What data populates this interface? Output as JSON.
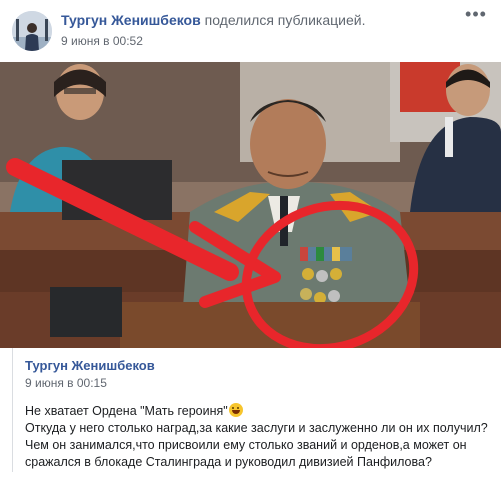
{
  "post": {
    "author": "Тургун Женишбеков",
    "action": "поделился публикацией.",
    "timestamp": "9 июня в 00:52",
    "more_icon": "more-dots-icon"
  },
  "shared_post": {
    "author": "Тургун Женишбеков",
    "timestamp": "9 июня в 00:15",
    "lines": [
      "Не хватает Ордена \"Мать героиня\"",
      "Откуда у него столько наград,за какие заслуги и заслуженно ли он их получил?",
      "Чем он занимался,что присвоили ему столько званий и орденов,а может он",
      "сражался в блокаде Сталинграда и руководил дивизией Панфилова?"
    ],
    "emoji": "grinning-face-emoji"
  },
  "colors": {
    "link_blue": "#365899",
    "meta_gray": "#616770",
    "annotation_red": "#e8262b"
  }
}
